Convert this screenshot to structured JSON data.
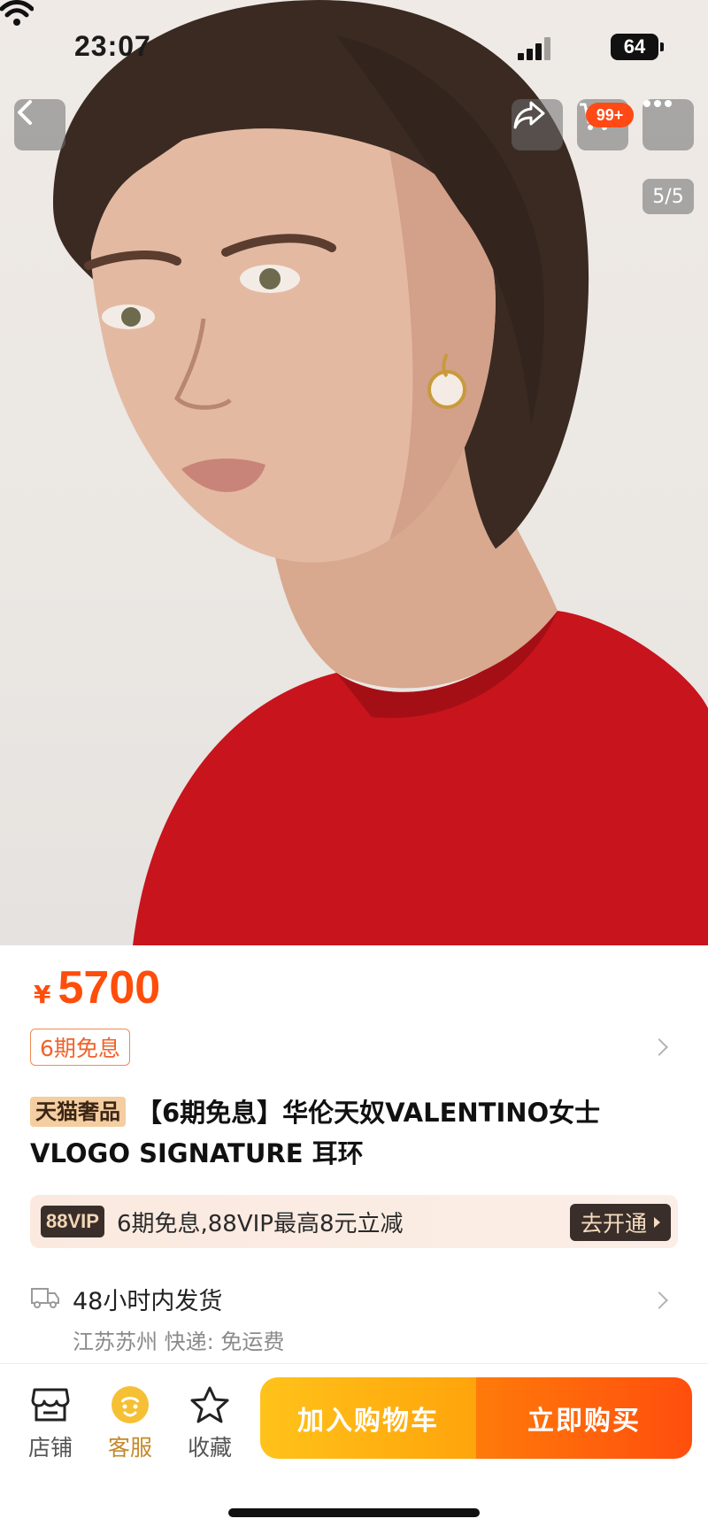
{
  "status": {
    "time": "23:07",
    "battery": "64"
  },
  "gallery": {
    "page_indicator": "5/5"
  },
  "header": {
    "cart_badge": "99+"
  },
  "product": {
    "currency": "¥",
    "price": "5700",
    "installment_tag": "6期免息",
    "store_tag": "天猫奢品",
    "title": "【6期免息】华伦天奴VALENTINO女士VLOGO SIGNATURE 耳环"
  },
  "vip": {
    "badge": "88VIP",
    "text": "6期免息,88VIP最高8元立减",
    "button": "去开通"
  },
  "delivery": {
    "time": "48小时内发货",
    "detail": "江苏苏州  快递: 免运费"
  },
  "bottom_bar": {
    "store": "店铺",
    "service": "客服",
    "favorite": "收藏",
    "add_to_cart": "加入购物车",
    "buy_now": "立即购买"
  },
  "colors": {
    "price": "#ff4d0a",
    "cart_button": "#ffb012",
    "buy_button": "#ff5a0c",
    "vip_dark": "#3a2e2a"
  },
  "icons": [
    "back-icon",
    "share-icon",
    "cart-icon",
    "more-icon",
    "truck-icon",
    "store-icon",
    "service-icon",
    "star-icon"
  ]
}
